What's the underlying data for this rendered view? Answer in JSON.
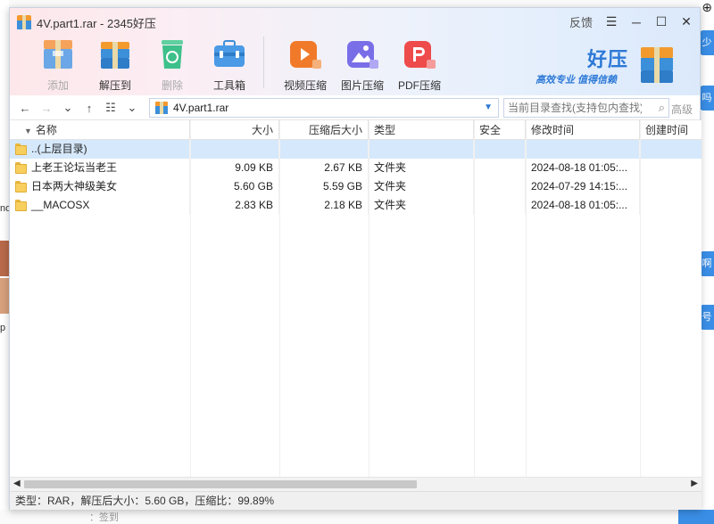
{
  "window": {
    "title": "4V.part1.rar - 2345好压"
  },
  "title_controls": {
    "feedback": "反馈",
    "menu": "☰",
    "minimize": "─",
    "maximize": "☐",
    "close": "✕"
  },
  "toolbar": [
    {
      "label": "添加",
      "disabled": true
    },
    {
      "label": "解压到",
      "disabled": false
    },
    {
      "label": "删除",
      "disabled": true
    },
    {
      "label": "工具箱",
      "disabled": false
    },
    {
      "label": "视频压缩",
      "disabled": false
    },
    {
      "label": "图片压缩",
      "disabled": false
    },
    {
      "label": "PDF压缩",
      "disabled": false
    }
  ],
  "brand": {
    "name": "好压",
    "slogan": "高效专业  值得信赖"
  },
  "address": {
    "path": "4V.part1.rar",
    "search_placeholder": "当前目录查找(支持包内查找)",
    "advanced": "高级"
  },
  "columns": [
    "名称",
    "大小",
    "压缩后大小",
    "类型",
    "安全",
    "修改时间",
    "创建时间"
  ],
  "rows": [
    {
      "name": "..(上层目录)",
      "size": "",
      "csize": "",
      "type": "",
      "security": "",
      "mtime": "",
      "ctime": "",
      "selected": true
    },
    {
      "name": "上老王论坛当老王",
      "size": "9.09 KB",
      "csize": "2.67 KB",
      "type": "文件夹",
      "security": "",
      "mtime": "2024-08-18 01:05:...",
      "ctime": ""
    },
    {
      "name": "日本两大神级美女",
      "size": "5.60 GB",
      "csize": "5.59 GB",
      "type": "文件夹",
      "security": "",
      "mtime": "2024-07-29 14:15:...",
      "ctime": ""
    },
    {
      "name": "__MACOSX",
      "size": "2.83 KB",
      "csize": "2.18 KB",
      "type": "文件夹",
      "security": "",
      "mtime": "2024-08-18 01:05:...",
      "ctime": ""
    }
  ],
  "status": "类型：RAR，解压后大小：5.60 GB，压缩比：99.89%",
  "background": {
    "left_text_1": "no",
    "left_text_2": "p",
    "right_tabs": [
      "少",
      "吗",
      "啊",
      "号"
    ],
    "bottom_text": "：签到"
  }
}
